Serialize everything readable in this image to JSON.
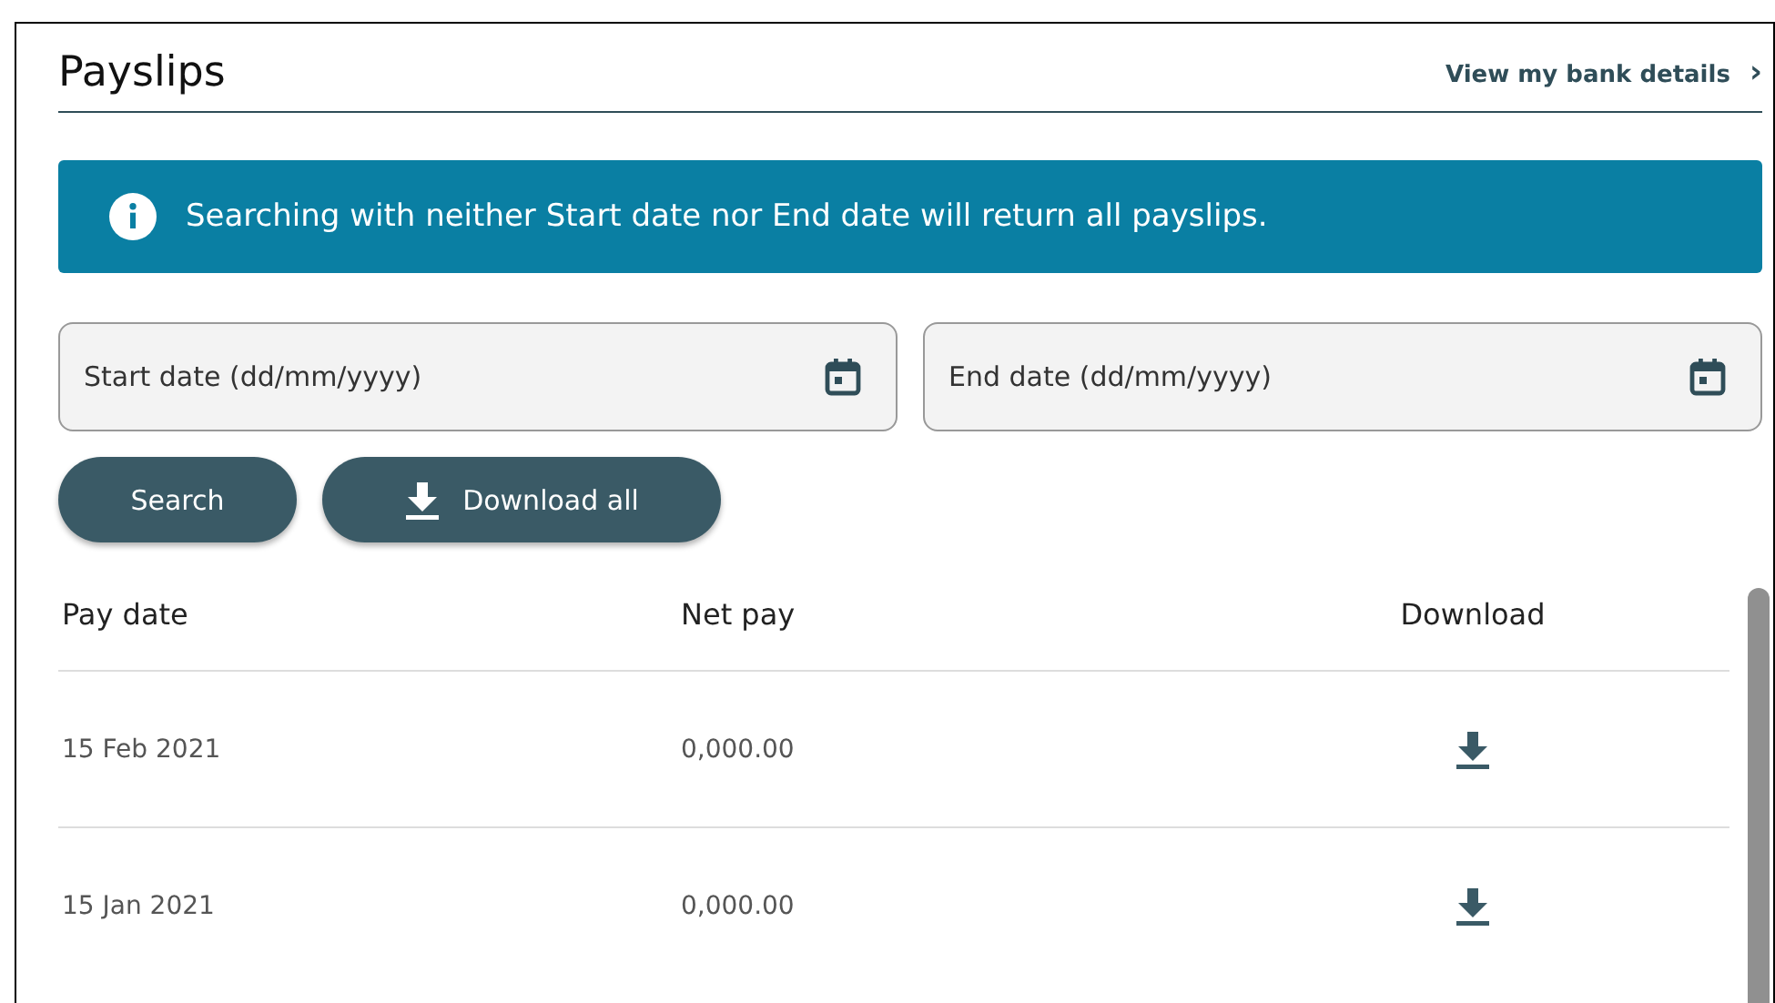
{
  "title": "Payslips",
  "bank_link": {
    "label": "View my bank details",
    "chevron": "›"
  },
  "info_banner": "Searching with neither Start date nor End date will return all payslips.",
  "fields": [
    {
      "placeholder": "Start date (dd/mm/yyyy)"
    },
    {
      "placeholder": "End date (dd/mm/yyyy)"
    }
  ],
  "buttons": [
    {
      "label": "Search",
      "kind": "plain"
    },
    {
      "label": "Download all",
      "kind": "download"
    }
  ],
  "table": {
    "columns": [
      "Pay date",
      "Net pay",
      "Download"
    ],
    "rows": [
      {
        "pay_date": "15 Feb 2021",
        "net_pay": "0,000.00"
      },
      {
        "pay_date": "15 Jan 2021",
        "net_pay": "0,000.00"
      }
    ]
  }
}
